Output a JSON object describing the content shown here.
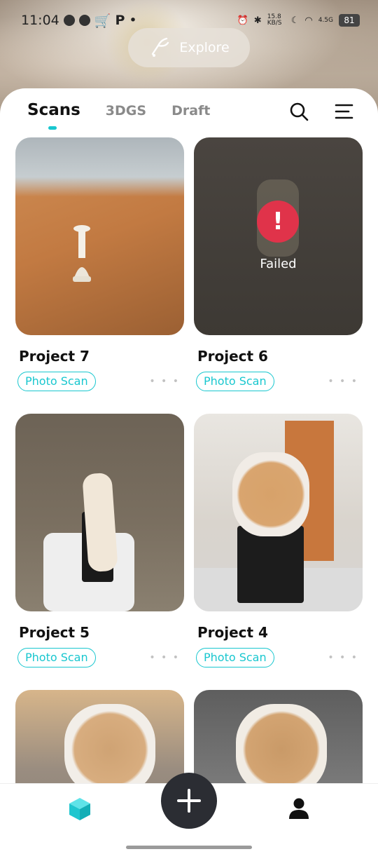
{
  "status_bar": {
    "time": "11:04",
    "network_speed": "15.8 KB/S",
    "signal": "4.5G",
    "battery": "81"
  },
  "explore": {
    "label": "Explore"
  },
  "tabs": [
    {
      "label": "Scans",
      "active": true
    },
    {
      "label": "3DGS",
      "active": false
    },
    {
      "label": "Draft",
      "active": false
    }
  ],
  "projects": [
    {
      "title": "Project 7",
      "tag": "Photo Scan",
      "status": ""
    },
    {
      "title": "Project 6",
      "tag": "Photo Scan",
      "status": "Failed"
    },
    {
      "title": "Project 5",
      "tag": "Photo Scan",
      "status": ""
    },
    {
      "title": "Project 4",
      "tag": "Photo Scan",
      "status": ""
    }
  ],
  "more_label": "• • •",
  "accent_color": "#19c7cf",
  "error_color": "#e0334a",
  "icons": {
    "search": "search-icon",
    "menu": "menu-icon",
    "cube": "cube-icon",
    "add": "plus-icon",
    "user": "user-icon"
  }
}
